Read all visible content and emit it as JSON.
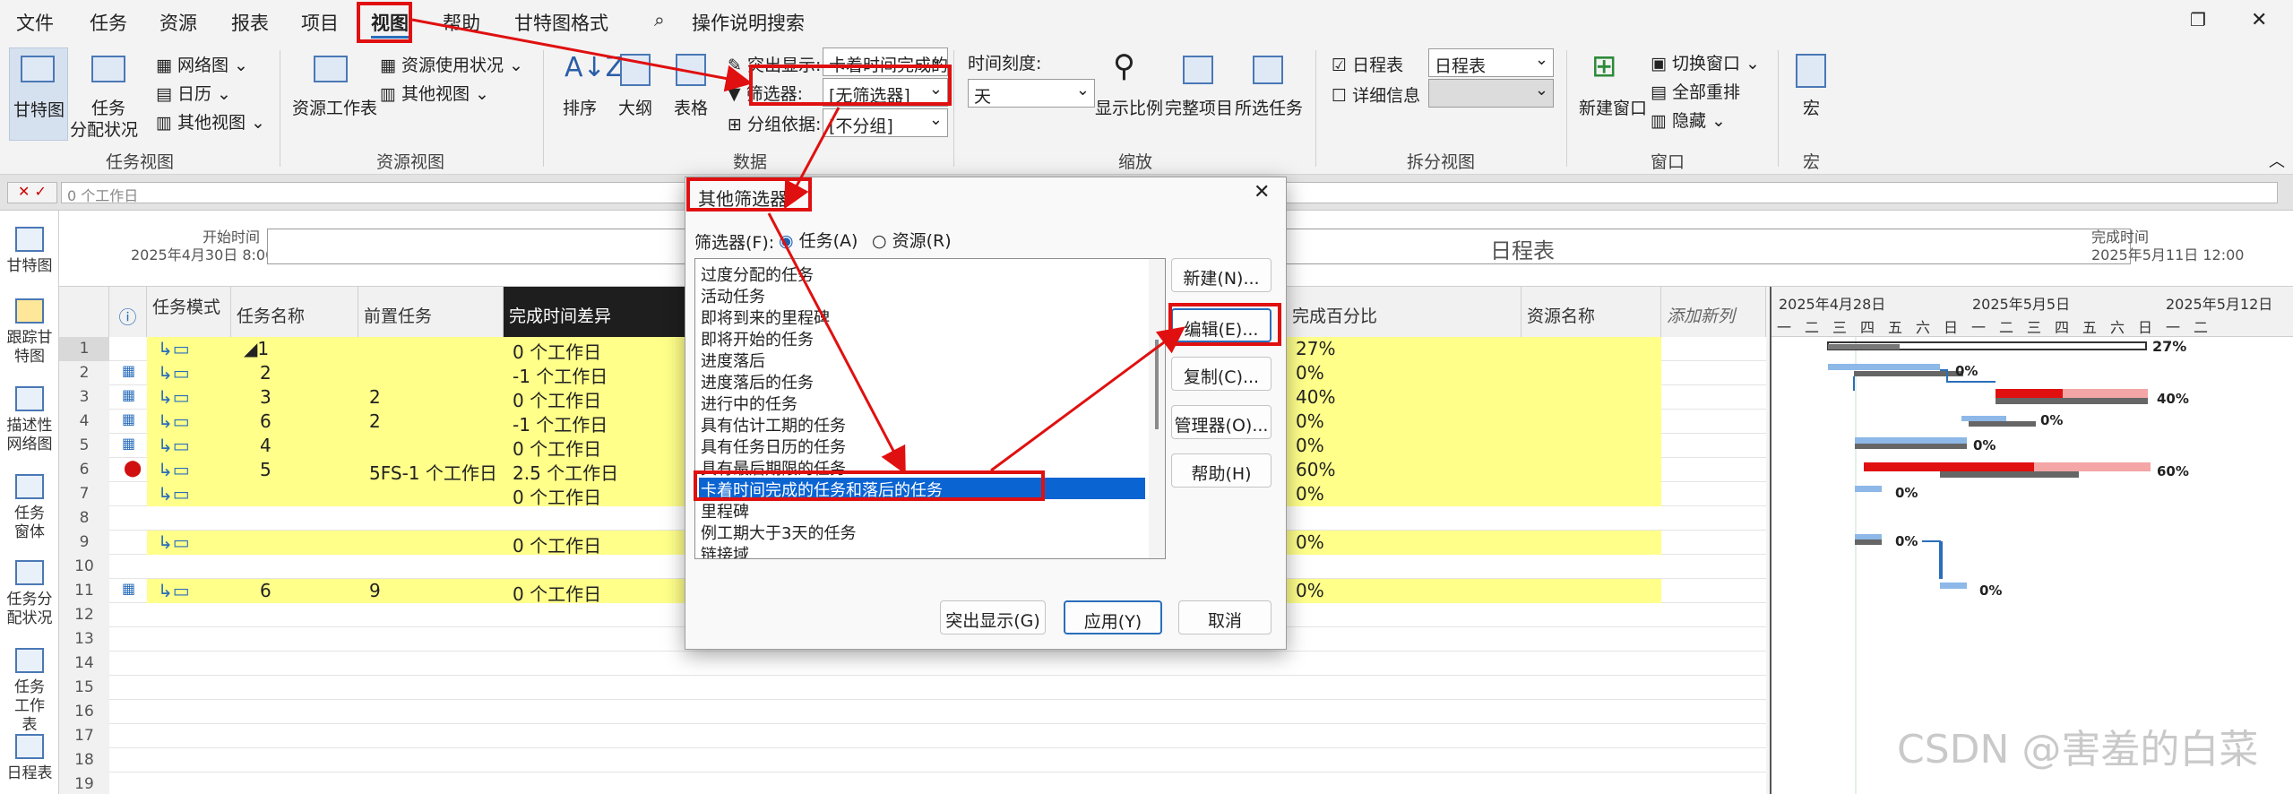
{
  "menu": {
    "file": "文件",
    "task": "任务",
    "resource": "资源",
    "report": "报表",
    "project": "项目",
    "view": "视图",
    "help": "帮助",
    "gantt_format": "甘特图格式",
    "tell_me": "操作说明搜索"
  },
  "ribbon": {
    "task_views": {
      "gantt": "甘特图",
      "task_usage_1": "任务",
      "task_usage_2": "分配状况",
      "network": "网络图",
      "calendar": "日历",
      "other": "其他视图",
      "group": "任务视图"
    },
    "resource_views": {
      "sheet": "资源工作表",
      "usage": "资源使用状况",
      "other": "其他视图",
      "group": "资源视图"
    },
    "data": {
      "sort": "排序",
      "outline": "大纲",
      "tables": "表格",
      "highlight": "突出显示:",
      "highlight_value": "卡着时间完成的",
      "filter": "筛选器:",
      "filter_value": "[无筛选器]",
      "group_by": "分组依据:",
      "group_value": "[不分组]",
      "group": "数据"
    },
    "zoom": {
      "timescale": "时间刻度:",
      "timescale_value": "天",
      "zoom": "显示比例",
      "entire": "完整项目",
      "selected": "所选任务",
      "group": "缩放"
    },
    "split": {
      "timeline": "日程表",
      "timeline_value": "日程表",
      "details": "详细信息",
      "group": "拆分视图"
    },
    "window": {
      "new": "新建窗口",
      "switch": "切换窗口",
      "arrange": "全部重排",
      "hide": "隐藏",
      "group": "窗口"
    },
    "macros": {
      "macro": "宏",
      "group": "宏"
    }
  },
  "formula_value": "0 个工作日",
  "viewbar": [
    "甘特图",
    "跟踪甘特图",
    "描述性网络图",
    "任务窗体",
    "任务分配状况",
    "任务工作表",
    "日程表"
  ],
  "timeline": {
    "start_label": "开始时间",
    "start_date": "2025年4月30日 8:00",
    "title": "日程表",
    "finish_label": "完成时间",
    "finish_date": "2025年5月11日 12:00"
  },
  "columns": {
    "mode": "任务模式",
    "name": "任务名称",
    "predecessors": "前置任务",
    "finish_variance": "完成时间差异",
    "percent": "完成百分比",
    "resource": "资源名称",
    "add": "添加新列"
  },
  "rows": [
    {
      "n": "1",
      "name": "1",
      "pred": "",
      "var": "0 个工作日",
      "pct": "27%"
    },
    {
      "n": "2",
      "name": "2",
      "pred": "",
      "var": "-1 个工作日",
      "pct": "0%"
    },
    {
      "n": "3",
      "name": "3",
      "pred": "2",
      "var": "0 个工作日",
      "pct": "40%"
    },
    {
      "n": "4",
      "name": "6",
      "pred": "2",
      "var": "-1 个工作日",
      "pct": "0%"
    },
    {
      "n": "5",
      "name": "4",
      "pred": "",
      "var": "0 个工作日",
      "pct": "0%"
    },
    {
      "n": "6",
      "name": "5",
      "pred": "5FS-1 个工作日",
      "var": "2.5 个工作日",
      "pct": "60%"
    },
    {
      "n": "7",
      "name": "",
      "pred": "",
      "var": "0 个工作日",
      "pct": "0%"
    },
    {
      "n": "8",
      "name": "",
      "pred": "",
      "var": "",
      "pct": ""
    },
    {
      "n": "9",
      "name": "",
      "pred": "",
      "var": "0 个工作日",
      "pct": "0%"
    },
    {
      "n": "10",
      "name": "",
      "pred": "",
      "var": "",
      "pct": ""
    },
    {
      "n": "11",
      "name": "6",
      "pred": "9",
      "var": "0 个工作日",
      "pct": "0%"
    },
    {
      "n": "12",
      "name": "",
      "pred": "",
      "var": "",
      "pct": ""
    },
    {
      "n": "13",
      "name": "",
      "pred": "",
      "var": "",
      "pct": ""
    },
    {
      "n": "14",
      "name": "",
      "pred": "",
      "var": "",
      "pct": ""
    },
    {
      "n": "15",
      "name": "",
      "pred": "",
      "var": "",
      "pct": ""
    },
    {
      "n": "16",
      "name": "",
      "pred": "",
      "var": "",
      "pct": ""
    },
    {
      "n": "17",
      "name": "",
      "pred": "",
      "var": "",
      "pct": ""
    },
    {
      "n": "18",
      "name": "",
      "pred": "",
      "var": "",
      "pct": ""
    },
    {
      "n": "19",
      "name": "",
      "pred": "",
      "var": "",
      "pct": ""
    }
  ],
  "gantt": {
    "weeks": [
      "2025年4月28日",
      "2025年5月5日",
      "2025年5月12日"
    ],
    "days": [
      "一",
      "二",
      "三",
      "四",
      "五",
      "六",
      "日",
      "一",
      "二",
      "三",
      "四",
      "五",
      "六",
      "日",
      "一",
      "二"
    ],
    "labels": [
      "27%",
      "0%",
      "40%",
      "0%",
      "0%",
      "60%",
      "0%",
      "0%",
      "0%"
    ]
  },
  "dialog": {
    "title": "其他筛选器",
    "filter_label": "筛选器(F):",
    "task": "任务(A)",
    "resource": "资源(R)",
    "items": [
      "过度分配的任务",
      "活动任务",
      "即将到来的里程碑",
      "即将开始的任务",
      "进度落后",
      "进度落后的任务",
      "进行中的任务",
      "具有估计工期的任务",
      "具有任务日历的任务",
      "具有最后期限的任务",
      "卡着时间完成的任务和落后的任务",
      "里程碑",
      "例工期大于3天的任务",
      "链接域"
    ],
    "selected": "卡着时间完成的任务和落后的任务",
    "new": "新建(N)...",
    "edit": "编辑(E)...",
    "copy": "复制(C)...",
    "organizer": "管理器(O)...",
    "help": "帮助(H)",
    "highlight": "突出显示(G)",
    "apply": "应用(Y)",
    "cancel": "取消"
  },
  "watermark": "CSDN @害羞的白菜"
}
